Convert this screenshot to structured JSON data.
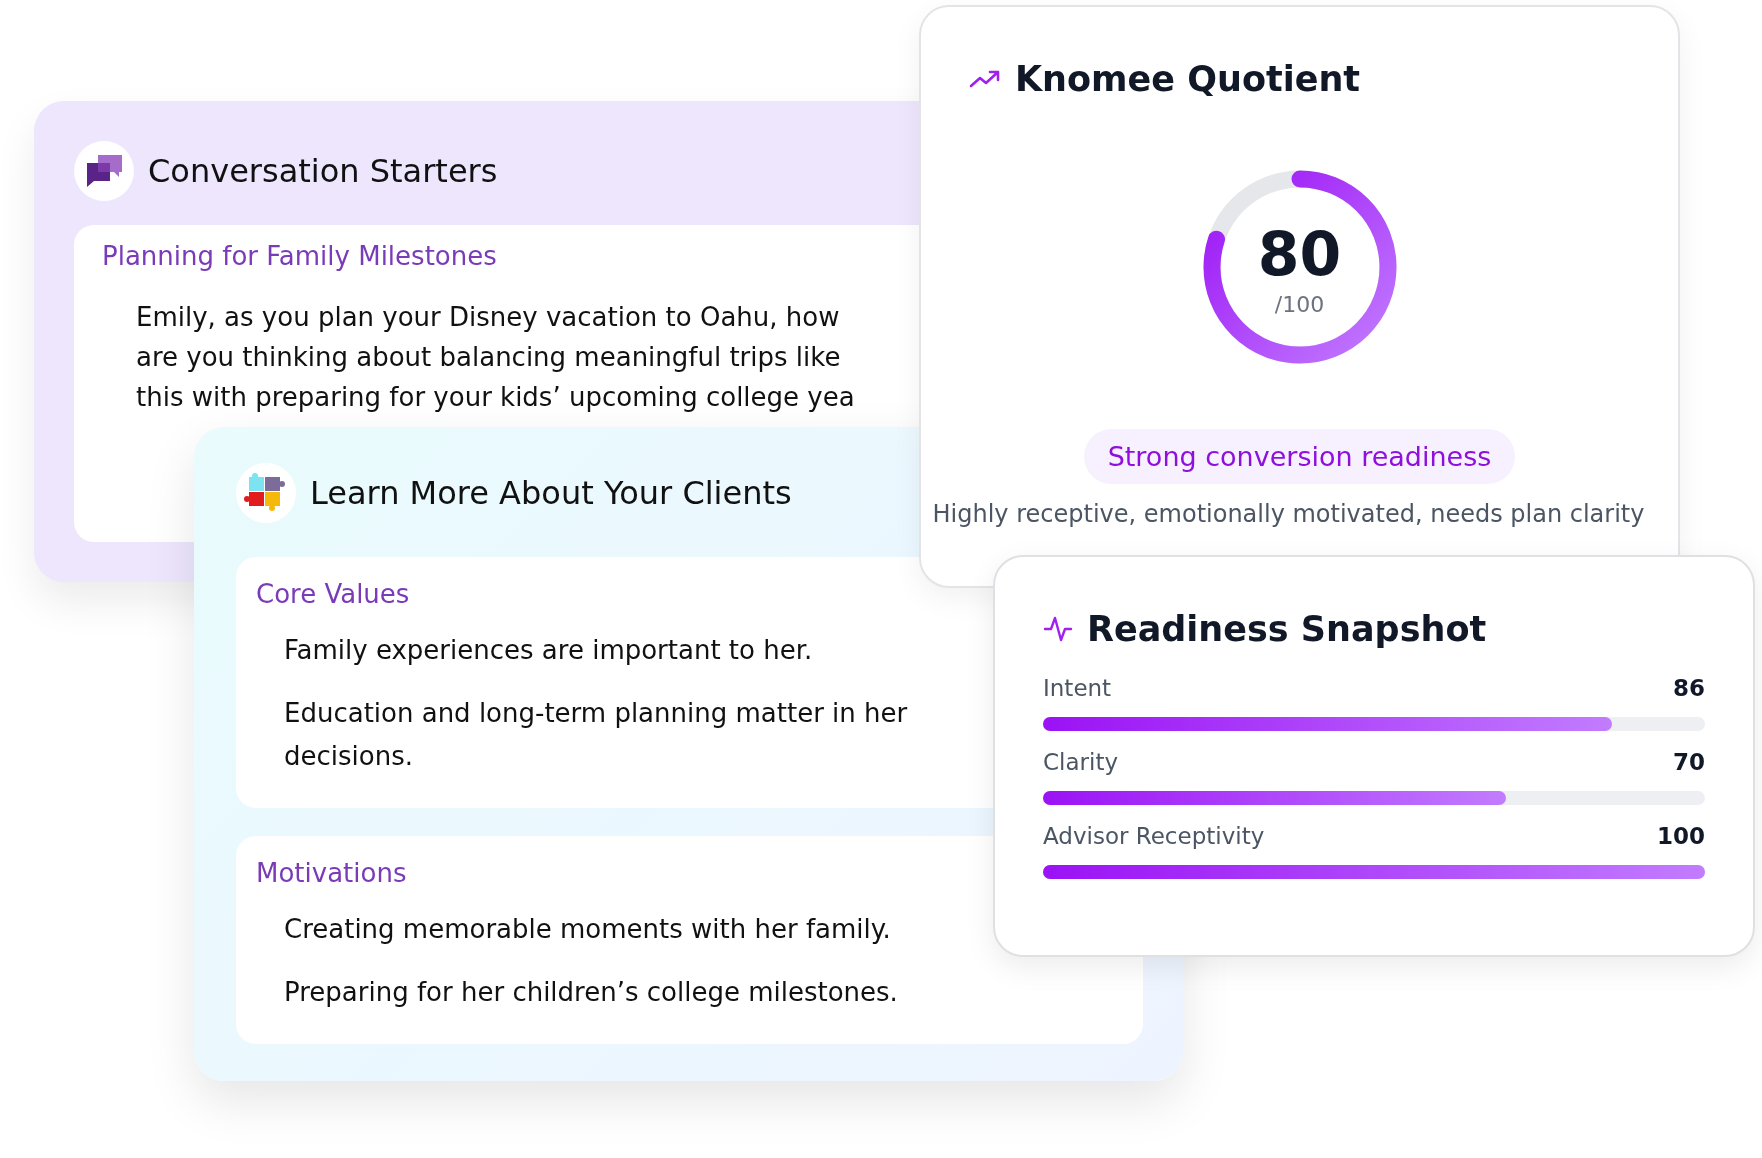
{
  "conversation_starters": {
    "title": "Conversation Starters",
    "topic": "Planning for Family Milestones",
    "text": "Emily, as you plan your Disney vacation to Oahu, how are you thinking about balancing meaningful trips like this with preparing for your kids’ upcoming college yea"
  },
  "clients": {
    "title": "Learn More About Your Clients",
    "sections": [
      {
        "title": "Core Values",
        "items": [
          "Family experiences are important to her.",
          "Education and long-term planning matter in her decisions."
        ]
      },
      {
        "title": "Motivations",
        "items": [
          "Creating memorable moments with her family.",
          "Preparing for her children’s college milestones."
        ]
      }
    ]
  },
  "quotient": {
    "title": "Knomee Quotient",
    "score": "80",
    "scale": "/100",
    "level": 0.8,
    "badge": "Strong conversion readiness",
    "description": "Highly receptive, emotionally motivated, needs plan clarity"
  },
  "readiness": {
    "title": "Readiness Snapshot",
    "metrics": [
      {
        "name": "Intent",
        "value": "86",
        "level": 0.86
      },
      {
        "name": "Clarity",
        "value": "70",
        "level": 0.7
      },
      {
        "name": "Advisor Receptivity",
        "value": "100",
        "level": 1
      }
    ]
  }
}
